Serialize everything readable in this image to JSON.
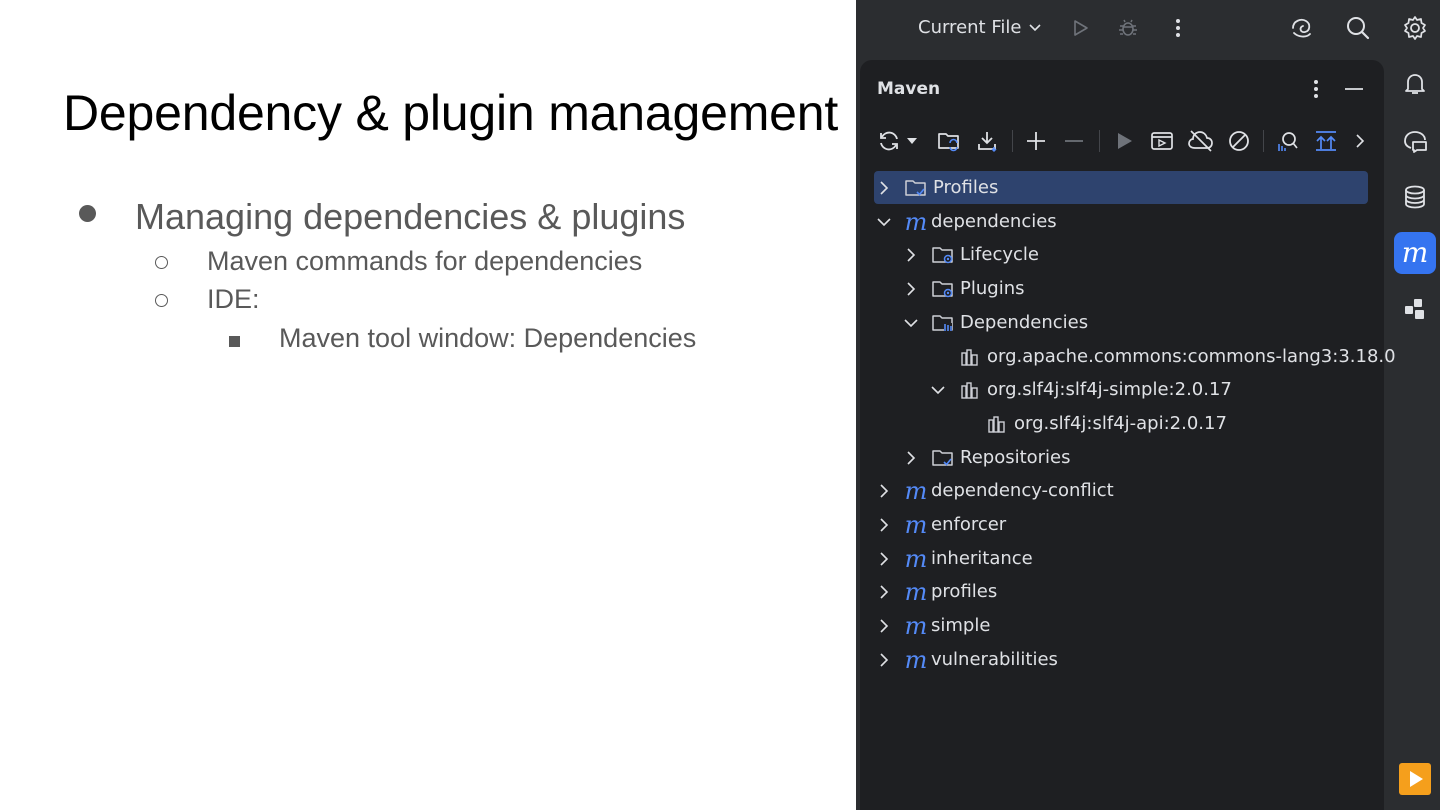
{
  "slide": {
    "title": "Dependency & plugin management",
    "bullets": [
      "Managing dependencies & plugins",
      "Maven commands for dependencies",
      "IDE:",
      "Maven tool window: Dependencies"
    ]
  },
  "ide": {
    "run_config": "Current File",
    "panel_title": "Maven",
    "tree": [
      {
        "label": "Profiles",
        "icon": "folder-check-icon",
        "arrow": "chevron-right"
      },
      {
        "label": "dependencies",
        "icon": "maven-module-icon",
        "arrow": "chevron-down"
      },
      {
        "label": "Lifecycle",
        "icon": "folder-gear-icon",
        "arrow": "chevron-right"
      },
      {
        "label": "Plugins",
        "icon": "folder-gear-icon",
        "arrow": "chevron-right"
      },
      {
        "label": "Dependencies",
        "icon": "folder-library-icon",
        "arrow": "chevron-down"
      },
      {
        "label": "org.apache.commons:commons-lang3:3.18.0",
        "icon": "library-icon",
        "arrow": ""
      },
      {
        "label": "org.slf4j:slf4j-simple:2.0.17",
        "icon": "library-icon",
        "arrow": "chevron-down"
      },
      {
        "label": "org.slf4j:slf4j-api:2.0.17",
        "icon": "library-icon",
        "arrow": ""
      },
      {
        "label": "Repositories",
        "icon": "folder-check-icon",
        "arrow": "chevron-right"
      },
      {
        "label": "dependency-conflict",
        "icon": "maven-module-icon",
        "arrow": "chevron-right"
      },
      {
        "label": "enforcer",
        "icon": "maven-module-icon",
        "arrow": "chevron-right"
      },
      {
        "label": "inheritance",
        "icon": "maven-module-icon",
        "arrow": "chevron-right"
      },
      {
        "label": "profiles",
        "icon": "maven-module-icon",
        "arrow": "chevron-right"
      },
      {
        "label": "simple",
        "icon": "maven-module-icon",
        "arrow": "chevron-right"
      },
      {
        "label": "vulnerabilities",
        "icon": "maven-module-icon",
        "arrow": "chevron-right"
      }
    ],
    "maven_glyph": "m",
    "colors": {
      "accent": "#3574f0",
      "selection": "#2e436e",
      "maven": "#548af7"
    }
  }
}
